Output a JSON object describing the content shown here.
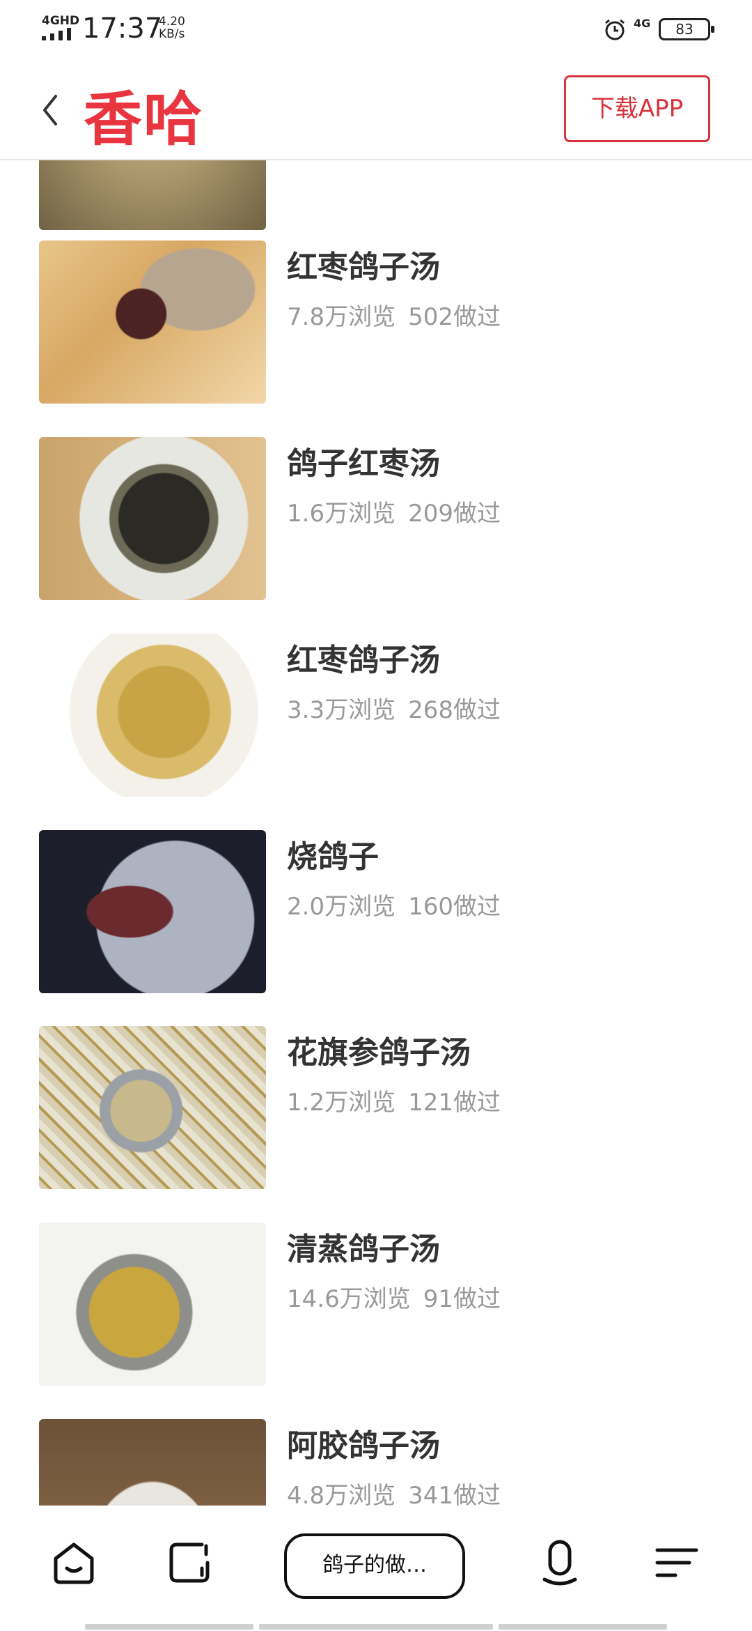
{
  "status_bar": {
    "network_label": "4GHD",
    "time": "17:37",
    "speed_value": "4.20",
    "speed_unit": "KB/s",
    "right_network": "4G",
    "battery": "83"
  },
  "header": {
    "logo": "香哈",
    "download_label": "下载APP"
  },
  "recipes": [
    {
      "title": "红枣鸽子汤",
      "views": "7.8万浏览",
      "made": "502做过"
    },
    {
      "title": "鸽子红枣汤",
      "views": "1.6万浏览",
      "made": "209做过"
    },
    {
      "title": "红枣鸽子汤",
      "views": "3.3万浏览",
      "made": "268做过"
    },
    {
      "title": "烧鸽子",
      "views": "2.0万浏览",
      "made": "160做过"
    },
    {
      "title": "花旗参鸽子汤",
      "views": "1.2万浏览",
      "made": "121做过"
    },
    {
      "title": "清蒸鸽子汤",
      "views": "14.6万浏览",
      "made": "91做过"
    },
    {
      "title": "阿胶鸽子汤",
      "views": "4.8万浏览",
      "made": "341做过"
    }
  ],
  "bottom_bar": {
    "search_text": "鸽子的做…",
    "icons": [
      "home-icon",
      "tabs-icon",
      "mic-icon",
      "menu-icon"
    ]
  },
  "colors": {
    "brand": "#e8353f",
    "meta_text": "#999999",
    "title_text": "#333333"
  }
}
